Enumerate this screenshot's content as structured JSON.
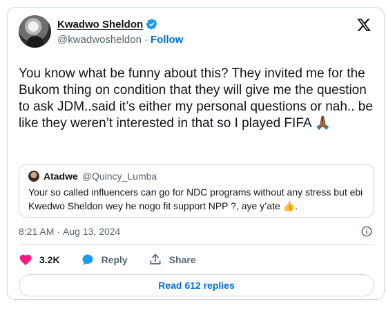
{
  "author": {
    "name": "Kwadwo Sheldon",
    "handle": "@kwadwosheldon",
    "separator": "·",
    "follow_label": "Follow"
  },
  "tweet": {
    "text": "You know what be funny about this? They invited me for the Bukom thing on condition that they will give me the question to ask JDM..said it’s either my personal questions or nah.. be like they weren’t interested in that so I played FIFA 🙏🏾",
    "time": "8:21 AM",
    "separator": "·",
    "date": "Aug 13, 2024"
  },
  "quoted": {
    "name": "Atadwe",
    "handle": "@Quincy_Lumba",
    "text": "Your so called influencers can go for NDC programs without any stress but ebi Kwedwo Sheldon wey he nogo fit support NPP ?, aye y’ate 👍."
  },
  "actions": {
    "likes": "3.2K",
    "reply_label": "Reply",
    "share_label": "Share"
  },
  "replies_button": "Read 612 replies",
  "colors": {
    "accent": "#006fd6",
    "like": "#f91880",
    "verified": "#1d9bf0",
    "reply_icon": "#1d9bf0",
    "border": "#cfd9de",
    "muted": "#536471"
  },
  "icons": [
    "verified-badge-icon",
    "x-logo-icon",
    "info-icon",
    "heart-icon",
    "reply-bubble-icon",
    "share-icon"
  ]
}
